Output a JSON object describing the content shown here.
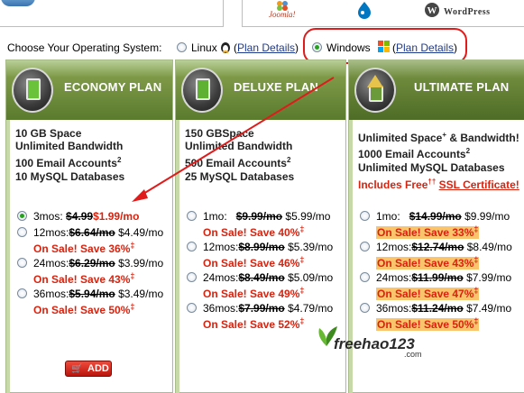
{
  "top_logos": {
    "joomla": "Joomla!",
    "wordpress": "WordPress"
  },
  "os_selector": {
    "label": "Choose Your Operating System:",
    "linux_label": "Linux",
    "linux_link": "Plan Details",
    "windows_label": "Windows",
    "windows_link": "Plan Details",
    "selected": "Windows"
  },
  "plans": {
    "economy": {
      "title": "ECONOMY PLAN",
      "space": "10 GB Space",
      "bandwidth": "Unlimited Bandwidth",
      "email": "100 Email Accounts",
      "email_sup": "2",
      "db": "10 MySQL Databases",
      "prices": [
        {
          "term": "3mos:",
          "old": "$4.99",
          "new": "$1.99/mo",
          "selected": true
        },
        {
          "term": "12mos:",
          "old": "$6.64/mo",
          "new": "$4.49/mo",
          "sale": "On Sale! Save 36%",
          "mark": "‡"
        },
        {
          "term": "24mos:",
          "old": "$6.29/mo",
          "new": "$3.99/mo",
          "sale": "On Sale! Save 43%",
          "mark": "‡"
        },
        {
          "term": "36mos:",
          "old": "$5.94/mo",
          "new": "$3.49/mo",
          "sale": "On Sale! Save 50%",
          "mark": "‡"
        }
      ],
      "add_label": "ADD"
    },
    "deluxe": {
      "title": "DELUXE PLAN",
      "space": "150 GBSpace",
      "bandwidth": "Unlimited Bandwidth",
      "email": "500 Email Accounts",
      "email_sup": "2",
      "db": "25 MySQL Databases",
      "prices": [
        {
          "term": "1mo:",
          "old": "$9.99/mo",
          "new": "$5.99/mo",
          "sale": "On Sale! Save 40%",
          "mark": "‡"
        },
        {
          "term": "12mos:",
          "old": "$8.99/mo",
          "new": "$5.39/mo",
          "sale": "On Sale! Save 46%",
          "mark": "‡"
        },
        {
          "term": "24mos:",
          "old": "$8.49/mo",
          "new": "$5.09/mo",
          "sale": "On Sale! Save 49%",
          "mark": "‡"
        },
        {
          "term": "36mos:",
          "old": "$7.99/mo",
          "new": "$4.79/mo",
          "sale": "On Sale! Save 52%",
          "mark": "‡"
        }
      ]
    },
    "ultimate": {
      "title": "ULTIMATE PLAN",
      "space": "Unlimited Space",
      "space_sup": "+",
      "bandwidth": "& Bandwidth!",
      "email": "1000 Email Accounts",
      "email_sup": "2",
      "db": "Unlimited MySQL Databases",
      "includes": "Includes Free",
      "includes_sup": "††",
      "ssl": "SSL Certificate!",
      "prices": [
        {
          "term": "1mo:",
          "old": "$14.99/mo",
          "new": "$9.99/mo",
          "sale": "On Sale! Save 33%",
          "mark": "‡"
        },
        {
          "term": "12mos:",
          "old": "$12.74/mo",
          "new": "$8.49/mo",
          "sale": "On Sale! Save 43%",
          "mark": "‡"
        },
        {
          "term": "24mos:",
          "old": "$11.99/mo",
          "new": "$7.99/mo",
          "sale": "On Sale! Save 47%",
          "mark": "‡"
        },
        {
          "term": "36mos:",
          "old": "$11.24/mo",
          "new": "$7.49/mo",
          "sale": "On Sale! Save 50%",
          "mark": "‡"
        }
      ]
    }
  },
  "watermark": {
    "text": "freehao123",
    "domain": ".com"
  },
  "colors": {
    "accent_red": "#d9230f",
    "plan_green": "#6e8a3c",
    "link_blue": "#1d3a91",
    "sale_highlight": "#f9c46b"
  }
}
